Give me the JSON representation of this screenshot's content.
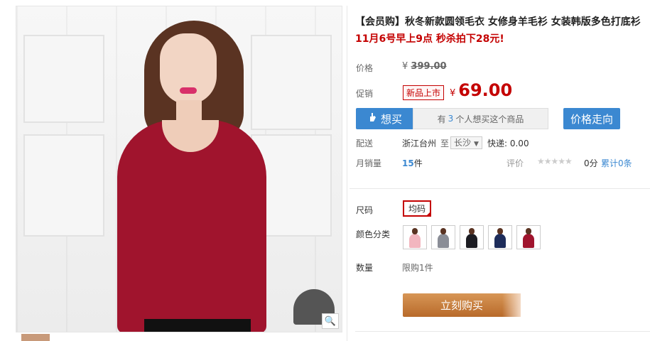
{
  "product": {
    "title": "【会员购】秋冬新款圆领毛衣 女修身羊毛衫 女装韩版多色打底衫",
    "promo_line": "11月6号早上9点 秒杀拍下28元!"
  },
  "price": {
    "label": "价格",
    "currency": "¥",
    "original": "399.00"
  },
  "promo": {
    "label": "促销",
    "badge": "新品上市",
    "currency": "¥",
    "price": "69.00"
  },
  "want": {
    "button_label": "想买",
    "info_prefix": "有",
    "count": "3",
    "info_suffix": "个人想买这个商品"
  },
  "trend": {
    "button_label": "价格走向"
  },
  "shipping": {
    "label": "配送",
    "from": "浙江台州",
    "to_word": "至",
    "city": "长沙",
    "express": "快递: 0.00"
  },
  "sales": {
    "label": "月销量",
    "count": "15",
    "unit": "件",
    "rating_label": "评价",
    "stars": "★★★★★",
    "score": "0分",
    "cumulative": "累计0条"
  },
  "size": {
    "label": "尺码",
    "option": "均码"
  },
  "color": {
    "label": "颜色分类",
    "swatches": [
      "#f2b6bf",
      "#8a8d96",
      "#1c1c22",
      "#1d2c5a",
      "#a0142d"
    ]
  },
  "quantity": {
    "label": "数量",
    "limit": "限购1件"
  },
  "buy": {
    "button_label": "立刻购买"
  },
  "icons": {
    "zoom": "🔍",
    "want": "hand-icon"
  },
  "colors": {
    "accent_blue": "#3b88d1",
    "price_red": "#c40000",
    "buy_orange": "#c27a3a"
  }
}
